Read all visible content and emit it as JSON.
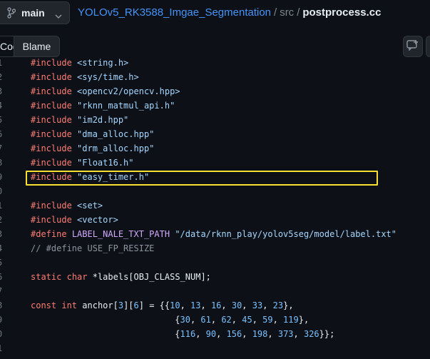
{
  "header": {
    "branch": "main",
    "repo": "YOLOv5_RK3588_Imgae_Segmentation",
    "separator": "/",
    "folder": "src",
    "file": "postprocess.cc"
  },
  "toolbar": {
    "code_label": "Code",
    "blame_label": "Blame"
  },
  "colors": {
    "highlight": "#f5e031",
    "keyword": "#ff7b72",
    "string": "#a5d6ff",
    "number": "#79c0ff",
    "comment": "#8b949e"
  },
  "code_lines": [
    {
      "n": "1",
      "tokens": [
        [
          "kw",
          "#include"
        ],
        [
          "pl",
          " "
        ],
        [
          "str",
          "<string.h>"
        ]
      ]
    },
    {
      "n": "2",
      "tokens": [
        [
          "kw",
          "#include"
        ],
        [
          "pl",
          " "
        ],
        [
          "str",
          "<sys/time.h>"
        ]
      ]
    },
    {
      "n": "3",
      "tokens": [
        [
          "kw",
          "#include"
        ],
        [
          "pl",
          " "
        ],
        [
          "str",
          "<opencv2/opencv.hpp>"
        ]
      ]
    },
    {
      "n": "4",
      "tokens": [
        [
          "kw",
          "#include"
        ],
        [
          "pl",
          " "
        ],
        [
          "str",
          "\"rknn_matmul_api.h\""
        ]
      ]
    },
    {
      "n": "5",
      "tokens": [
        [
          "kw",
          "#include"
        ],
        [
          "pl",
          " "
        ],
        [
          "str",
          "\"im2d.hpp\""
        ]
      ]
    },
    {
      "n": "6",
      "tokens": [
        [
          "kw",
          "#include"
        ],
        [
          "pl",
          " "
        ],
        [
          "str",
          "\"dma_alloc.hpp\""
        ]
      ]
    },
    {
      "n": "7",
      "tokens": [
        [
          "kw",
          "#include"
        ],
        [
          "pl",
          " "
        ],
        [
          "str",
          "\"drm_alloc.hpp\""
        ]
      ]
    },
    {
      "n": "8",
      "tokens": [
        [
          "kw",
          "#include"
        ],
        [
          "pl",
          " "
        ],
        [
          "str",
          "\"Float16.h\""
        ]
      ]
    },
    {
      "n": "9",
      "tokens": [
        [
          "kw",
          "#include"
        ],
        [
          "pl",
          " "
        ],
        [
          "str",
          "\"easy_timer.h\""
        ]
      ]
    },
    {
      "n": "0",
      "tokens": []
    },
    {
      "n": "1",
      "tokens": [
        [
          "kw",
          "#include"
        ],
        [
          "pl",
          " "
        ],
        [
          "str",
          "<set>"
        ]
      ]
    },
    {
      "n": "2",
      "tokens": [
        [
          "kw",
          "#include"
        ],
        [
          "pl",
          " "
        ],
        [
          "str",
          "<vector>"
        ]
      ]
    },
    {
      "n": "3",
      "tokens": [
        [
          "kw",
          "#define"
        ],
        [
          "pl",
          " "
        ],
        [
          "def",
          "LABEL_NALE_TXT_PATH"
        ],
        [
          "pl",
          " "
        ],
        [
          "str",
          "\"/data/rknn_play/yolov5seg/model/label.txt\""
        ]
      ]
    },
    {
      "n": "4",
      "tokens": [
        [
          "com",
          "// #define USE_FP_RESIZE"
        ]
      ]
    },
    {
      "n": "5",
      "tokens": []
    },
    {
      "n": "6",
      "tokens": [
        [
          "kw",
          "static"
        ],
        [
          "pl",
          " "
        ],
        [
          "kw",
          "char"
        ],
        [
          "pl",
          " *labels[OBJ_CLASS_NUM];"
        ]
      ]
    },
    {
      "n": "7",
      "tokens": []
    },
    {
      "n": "8",
      "tokens": [
        [
          "kw",
          "const"
        ],
        [
          "pl",
          " "
        ],
        [
          "kw",
          "int"
        ],
        [
          "pl",
          " anchor["
        ],
        [
          "num",
          "3"
        ],
        [
          "pl",
          "]["
        ],
        [
          "num",
          "6"
        ],
        [
          "pl",
          "] = {{"
        ],
        [
          "num",
          "10"
        ],
        [
          "pl",
          ", "
        ],
        [
          "num",
          "13"
        ],
        [
          "pl",
          ", "
        ],
        [
          "num",
          "16"
        ],
        [
          "pl",
          ", "
        ],
        [
          "num",
          "30"
        ],
        [
          "pl",
          ", "
        ],
        [
          "num",
          "33"
        ],
        [
          "pl",
          ", "
        ],
        [
          "num",
          "23"
        ],
        [
          "pl",
          "},"
        ]
      ]
    },
    {
      "n": "9",
      "tokens": [
        [
          "pl",
          "                            {"
        ],
        [
          "num",
          "30"
        ],
        [
          "pl",
          ", "
        ],
        [
          "num",
          "61"
        ],
        [
          "pl",
          ", "
        ],
        [
          "num",
          "62"
        ],
        [
          "pl",
          ", "
        ],
        [
          "num",
          "45"
        ],
        [
          "pl",
          ", "
        ],
        [
          "num",
          "59"
        ],
        [
          "pl",
          ", "
        ],
        [
          "num",
          "119"
        ],
        [
          "pl",
          "},"
        ]
      ]
    },
    {
      "n": "0",
      "tokens": [
        [
          "pl",
          "                            {"
        ],
        [
          "num",
          "116"
        ],
        [
          "pl",
          ", "
        ],
        [
          "num",
          "90"
        ],
        [
          "pl",
          ", "
        ],
        [
          "num",
          "156"
        ],
        [
          "pl",
          ", "
        ],
        [
          "num",
          "198"
        ],
        [
          "pl",
          ", "
        ],
        [
          "num",
          "373"
        ],
        [
          "pl",
          ", "
        ],
        [
          "num",
          "326"
        ],
        [
          "pl",
          "}};"
        ]
      ]
    },
    {
      "n": "1",
      "tokens": []
    }
  ]
}
